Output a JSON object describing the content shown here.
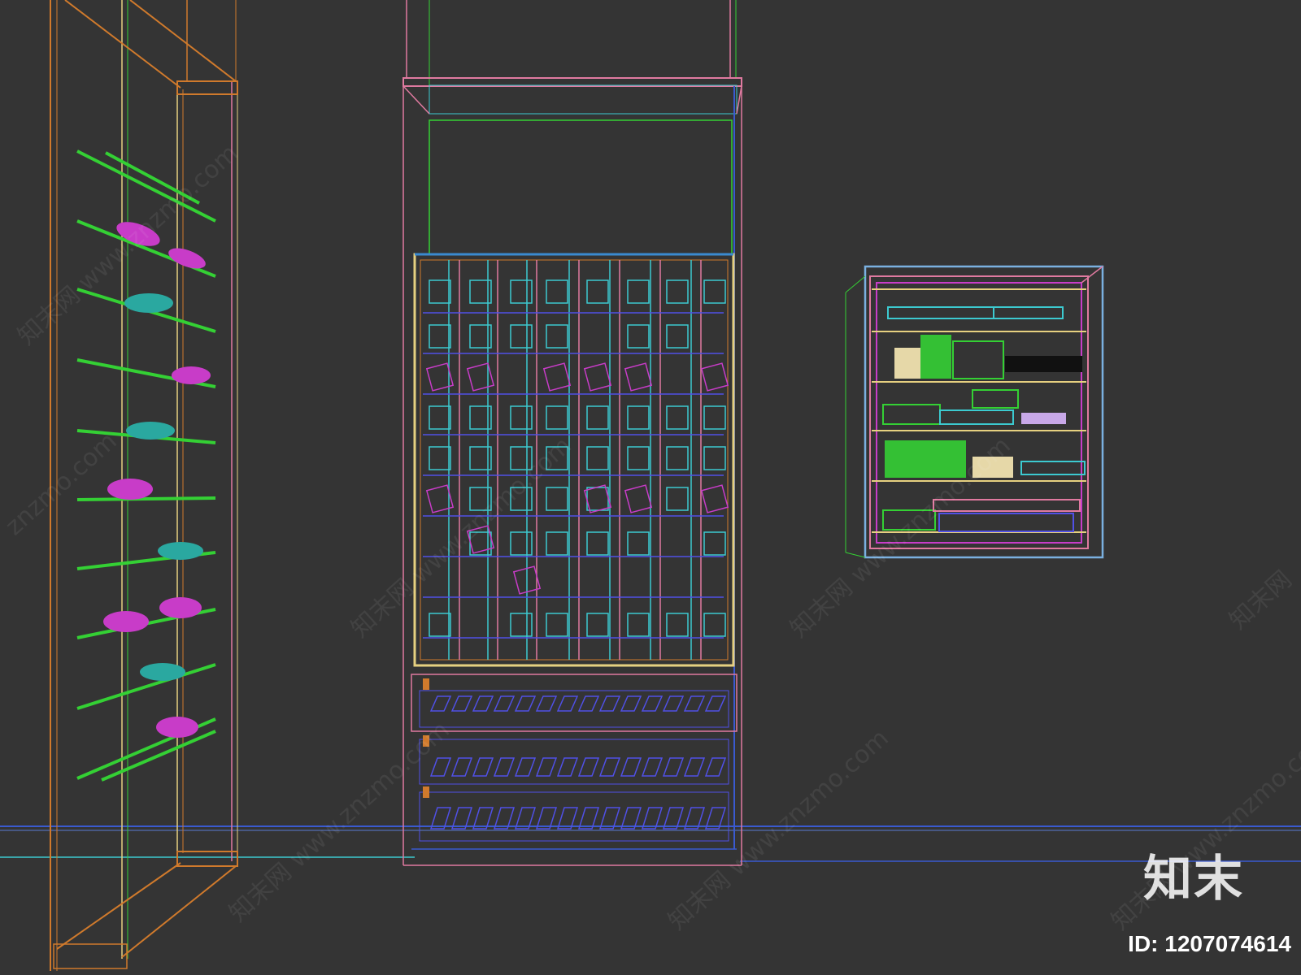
{
  "watermark": {
    "url_text": "www.znzmo.com",
    "brand_cn": "知末网",
    "brand_short": "znzmo.com"
  },
  "logo": {
    "text": "知末",
    "id_text": "ID: 1207074614"
  },
  "colors": {
    "background": "#343434",
    "wire_green": "#34d034",
    "wire_magenta": "#c83cc8",
    "wire_cyan": "#3ccad0",
    "wire_blue": "#5050e6",
    "wire_orange": "#d07a2c",
    "wire_yellow": "#e6d080",
    "wire_pink": "#e07aa0"
  },
  "scene": {
    "objects": [
      "shoe-rack-tower",
      "shoe-display-cabinet",
      "wall-shelf-cabinet"
    ]
  }
}
